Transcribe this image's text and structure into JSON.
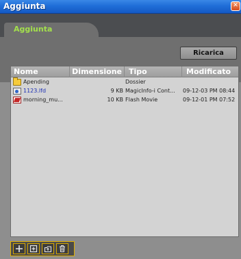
{
  "window": {
    "title": "Aggiunta",
    "close_icon": "close-icon"
  },
  "tabs": [
    {
      "label": "Aggiunta",
      "active": true
    }
  ],
  "toolbar": {
    "reload_label": "Ricarica"
  },
  "file_list": {
    "columns": [
      "Nome",
      "Dimensione",
      "Tipo",
      "Modificato"
    ],
    "rows": [
      {
        "icon": "folder-icon",
        "name": "Apending",
        "size": "",
        "type": "Dossier",
        "modified": ""
      },
      {
        "icon": "magicinfo-file-icon",
        "name": "1123.lfd",
        "size": "9 KB",
        "type": "MagicInfo-i Cont...",
        "modified": "09-12-03 PM 08:44"
      },
      {
        "icon": "flash-movie-icon",
        "name": "morning_mu...",
        "size": "10 KB",
        "type": "Flash Movie",
        "modified": "09-12-01 PM 07:52"
      }
    ]
  },
  "bottom_tools": [
    {
      "icon": "add-icon"
    },
    {
      "icon": "import-icon"
    },
    {
      "icon": "upload-folder-icon"
    },
    {
      "icon": "trash-icon"
    }
  ],
  "colors": {
    "titlebar": "#1f6ed8",
    "tab_label": "#a3e04c",
    "link": "#1b2fb5",
    "tool_border": "#d9a800"
  }
}
